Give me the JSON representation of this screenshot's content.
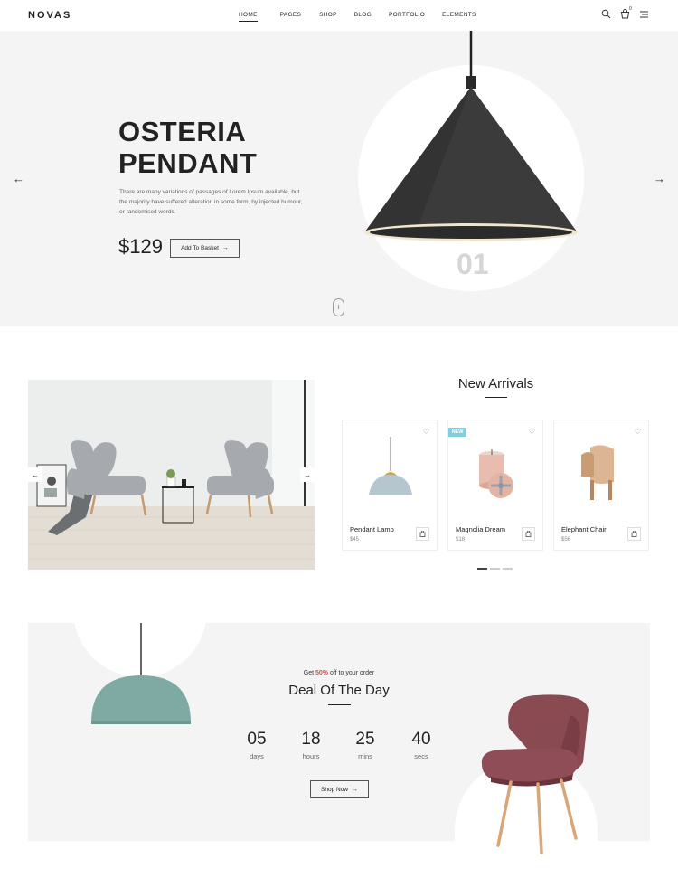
{
  "brand": {
    "logo": "NOVAS"
  },
  "nav": [
    {
      "label": "HOME",
      "active": true
    },
    {
      "label": "PAGES",
      "active": false
    },
    {
      "label": "SHOP",
      "active": false
    },
    {
      "label": "BLOG",
      "active": false
    },
    {
      "label": "PORTFOLIO",
      "active": false
    },
    {
      "label": "ELEMENTS",
      "active": false
    }
  ],
  "header_icons": {
    "search": "search-icon",
    "cart": "cart-icon",
    "cart_count": "0",
    "menu": "menu-icon"
  },
  "hero": {
    "title_line1": "OSTERIA",
    "title_line2": "PENDANT",
    "description": "There are many variations of passages of Lorem Ipsum available, but the majority have suffered alteration in some form, by injected humour, or randomised words.",
    "price": "$129",
    "button_label": "Add To Basket",
    "slide_number": "01",
    "prev_arrow": "←",
    "next_arrow": "→"
  },
  "new_arrivals": {
    "title": "New Arrivals",
    "products": [
      {
        "name": "Pendant Lamp",
        "price": "$45",
        "badge": ""
      },
      {
        "name": "Magnolia Dream",
        "price": "$18",
        "badge": "NEW"
      },
      {
        "name": "Elephant Chair",
        "price": "$56",
        "badge": ""
      }
    ]
  },
  "deal": {
    "subtitle_prefix": "Get ",
    "subtitle_highlight": "50%",
    "subtitle_suffix": " off to your order",
    "title": "Deal Of The Day",
    "countdown": [
      {
        "value": "05",
        "label": "days"
      },
      {
        "value": "18",
        "label": "hours"
      },
      {
        "value": "25",
        "label": "mins"
      },
      {
        "value": "40",
        "label": "secs"
      }
    ],
    "button_label": "Shop Now"
  },
  "colors": {
    "accent_red": "#e64545",
    "badge_teal": "#7fcfdc",
    "lamp_teal": "#7fa9a3",
    "chair_maroon": "#8a4a52"
  }
}
